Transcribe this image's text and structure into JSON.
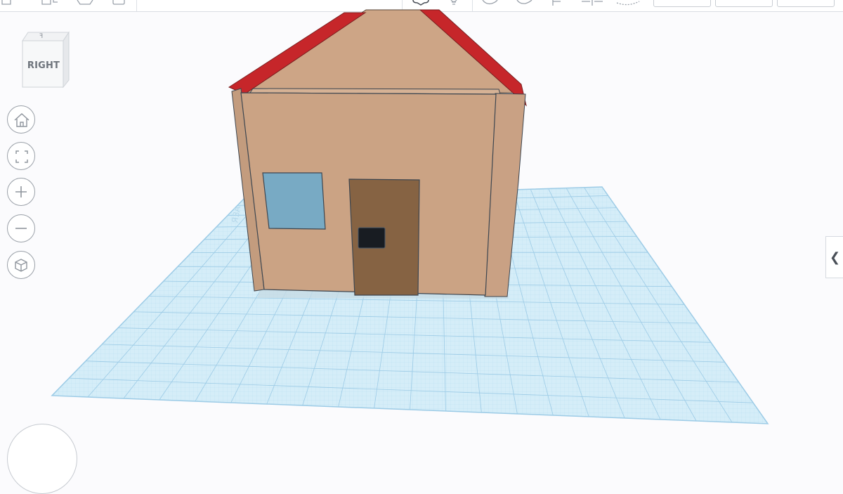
{
  "viewport": {
    "background": "#fbfbfd",
    "workplane_color": "#d4ecf7",
    "grid_line_color": "#a9d4ec"
  },
  "toolbar": {
    "icons": [
      "new-shape-icon",
      "copy-icon",
      "paste-icon",
      "delete-icon",
      "comment-icon",
      "light-icon",
      "undo-icon",
      "redo-icon",
      "align-icon",
      "mirror-icon",
      "group-icon"
    ]
  },
  "viewcube": {
    "label": "RIGHT",
    "top_face_label": "ꟻ"
  },
  "nav_controls": {
    "home": "home-icon",
    "fit": "fit-to-view-icon",
    "zoom_in": "zoom-in-icon",
    "zoom_out": "zoom-out-icon",
    "ortho": "perspective-cube-icon"
  },
  "panel_toggle": {
    "glyph": "❮"
  },
  "model": {
    "wall_color": "#cba384",
    "roof_color": "#c6262a",
    "window_color": "#78aac4",
    "door_color": "#866343",
    "doorknob_color": "#181c22"
  }
}
